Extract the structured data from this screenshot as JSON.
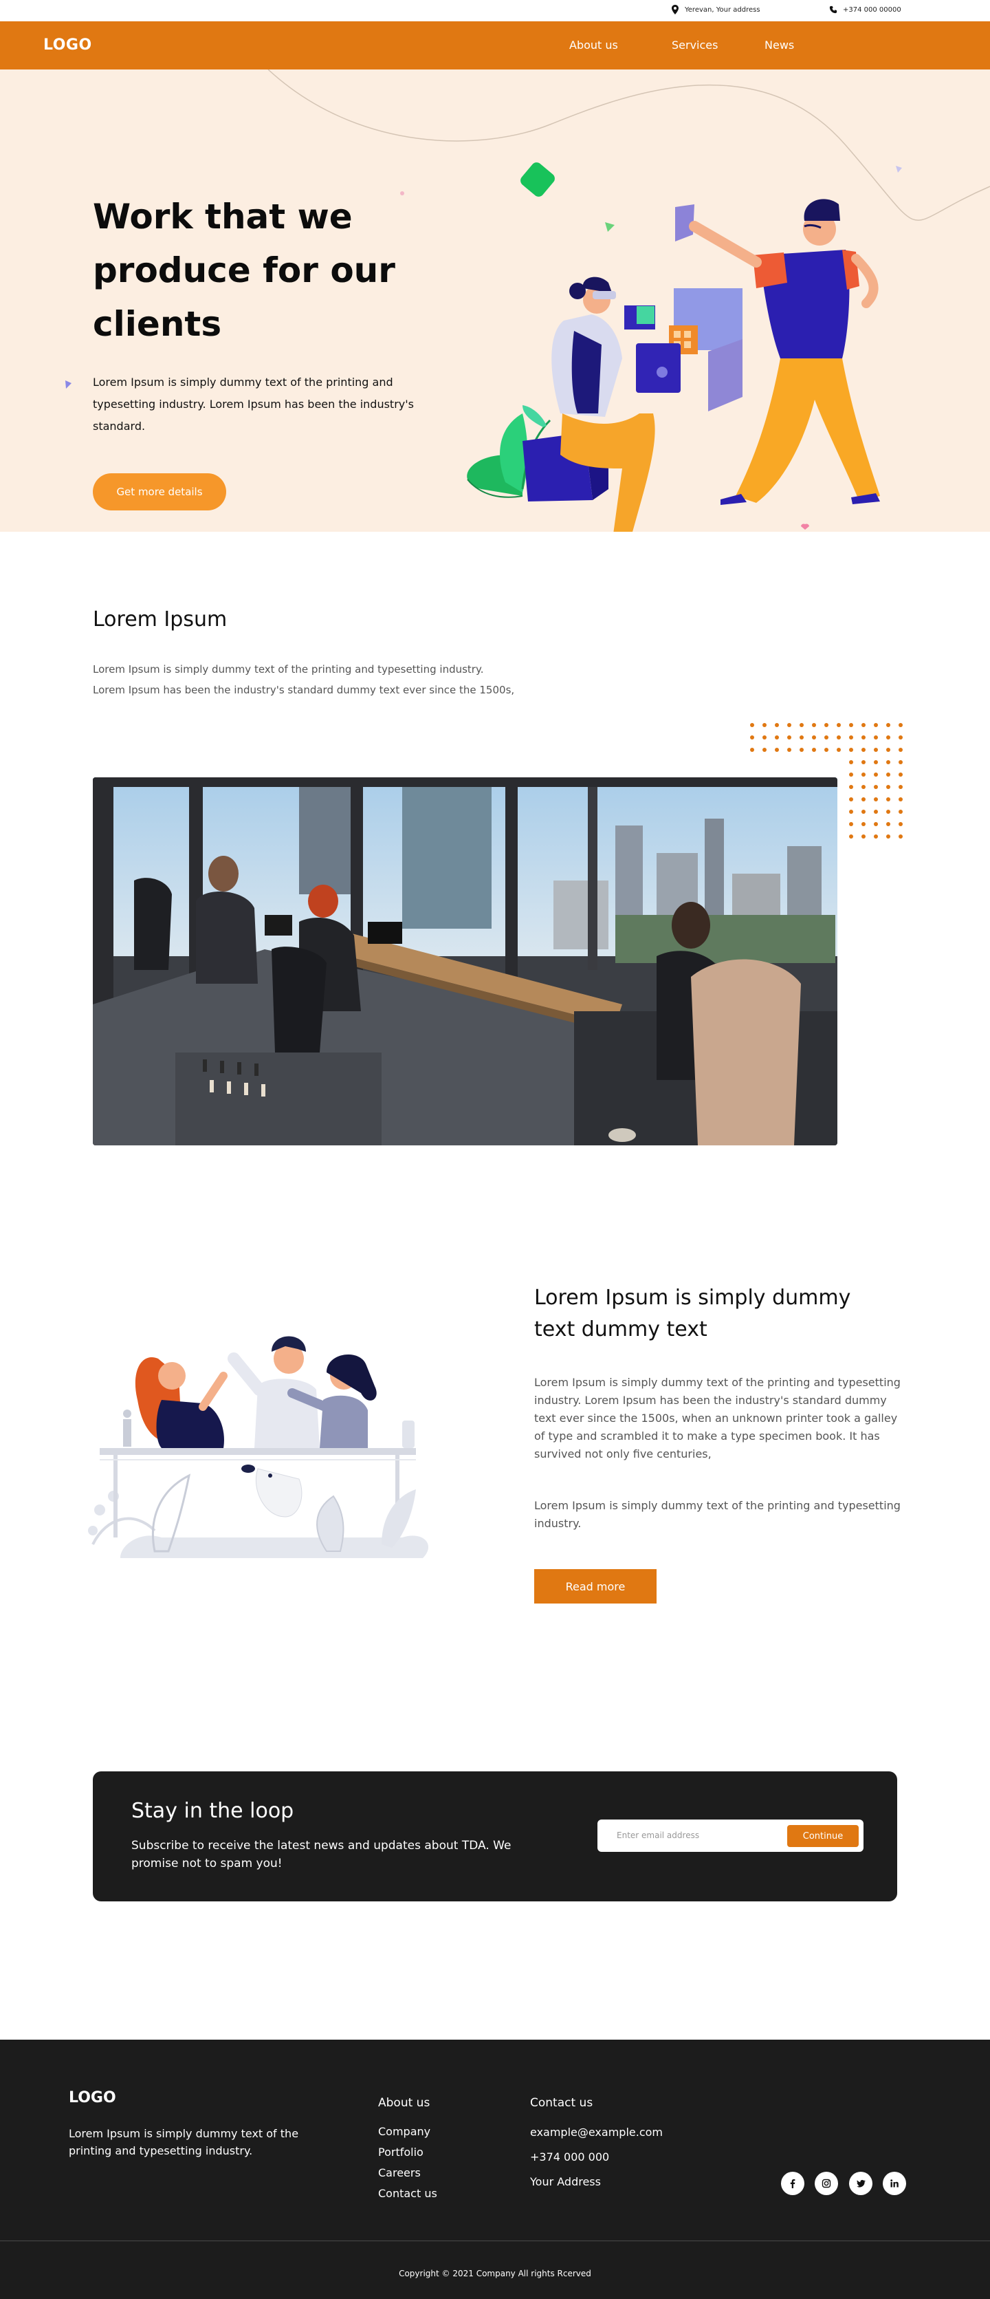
{
  "topbar": {
    "address": "Yerevan, Your address",
    "phone": "+374 000 00000"
  },
  "header": {
    "logo": "LOGO",
    "nav": [
      "About us",
      "Services",
      "News"
    ]
  },
  "hero": {
    "title": "Work that we produce for our clients",
    "text": "Lorem Ipsum is simply dummy text of the printing and typesetting industry. Lorem Ipsum has been the industry's standard.",
    "cta": "Get more details"
  },
  "section2": {
    "title": "Lorem Ipsum",
    "text": "Lorem Ipsum is simply dummy text of the printing and typesetting industry. Lorem Ipsum has been the industry's standard dummy text ever since the 1500s,"
  },
  "section3": {
    "title": "Lorem Ipsum is simply dummy text dummy text",
    "p1": "Lorem Ipsum is simply dummy text of the printing and typesetting industry. Lorem Ipsum has been the industry's standard dummy text ever since the 1500s, when an unknown printer took a galley of type and scrambled it to make a type specimen book. It has survived not only five centuries,",
    "p2": "Lorem Ipsum is simply dummy text of the printing and typesetting industry.",
    "cta": "Read more"
  },
  "newsletter": {
    "title": "Stay in the loop",
    "text": "Subscribe to receive the latest news and updates about TDA. We promise not to spam you!",
    "placeholder": "Enter email address",
    "button": "Continue"
  },
  "footer": {
    "logo": "LOGO",
    "description": "Lorem Ipsum is simply dummy text of the printing and typesetting industry.",
    "about_title": "About us",
    "about_links": [
      "Company",
      "Portfolio",
      "Careers",
      "Contact us"
    ],
    "contact_title": "Contact us",
    "contact_lines": [
      "example@example.com",
      "+374 000 000",
      "Your Address"
    ],
    "social_icons": [
      "facebook-icon",
      "instagram-icon",
      "twitter-icon",
      "linkedin-icon"
    ],
    "copyright": "Copyright © 2021 Company All rights Rcerved"
  },
  "colors": {
    "accent": "#e07812",
    "hero_bg": "#fceee1",
    "dark": "#1c1c1c",
    "hero_button": "#f6972a"
  }
}
